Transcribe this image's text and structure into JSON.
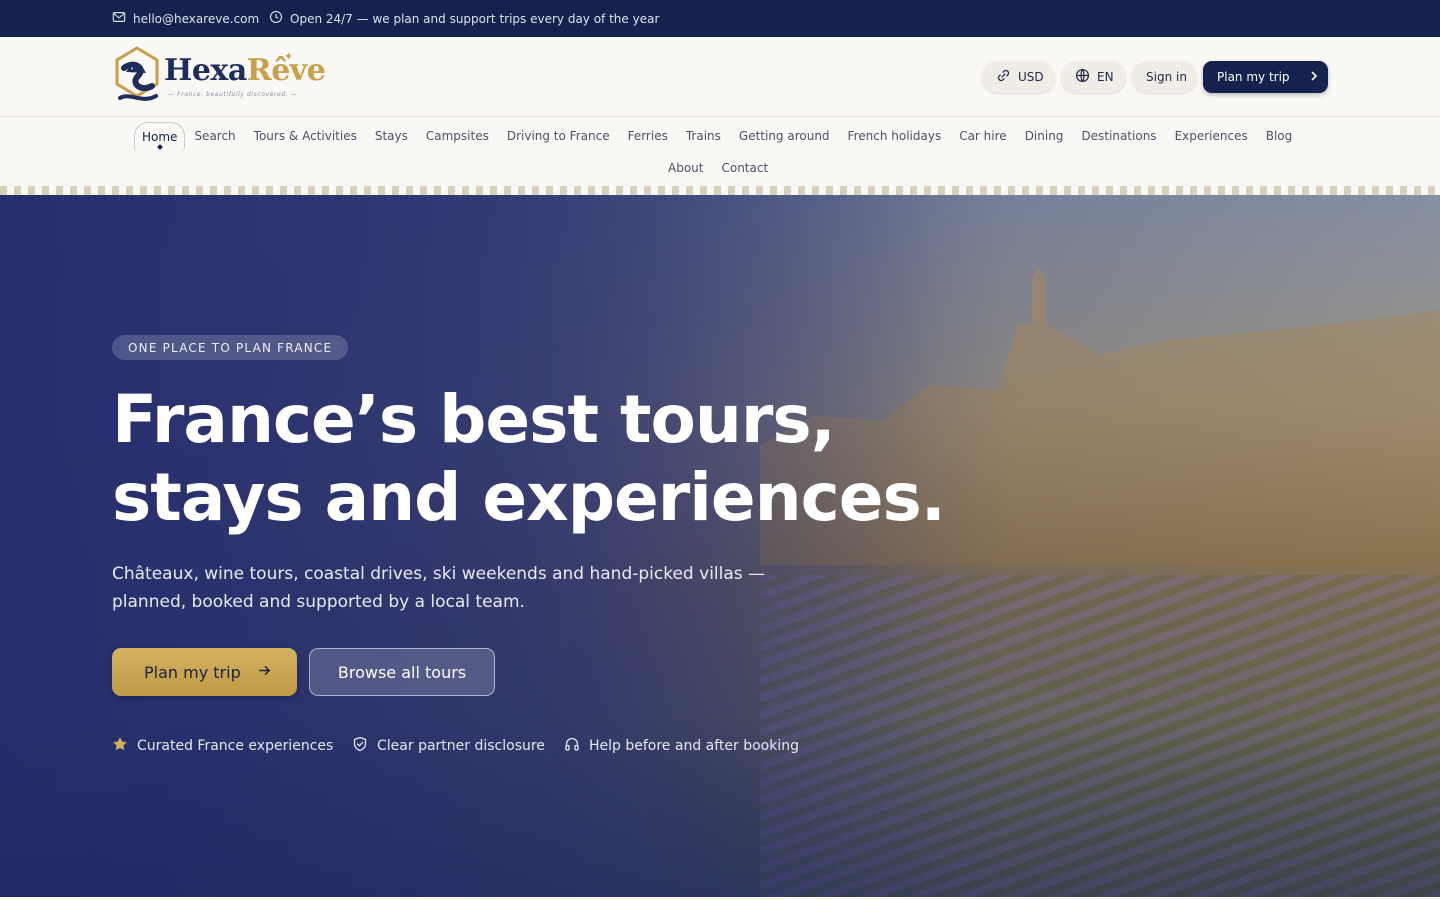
{
  "topbar": {
    "email": "hello@hexareve.com",
    "hours": "Open 24/7 — we plan and support trips every day of the year",
    "email_icon": "mail-icon",
    "hours_icon": "clock-icon"
  },
  "brand": {
    "name_part1": "Hexa",
    "name_part2": "Rêve",
    "tagline": "— France, beautifully discovered. —",
    "colors": {
      "navy": "#14224d",
      "gold": "#c9a14a"
    }
  },
  "header": {
    "currency": "USD",
    "language": "EN",
    "sign_in": "Sign in",
    "cta": "Plan my trip"
  },
  "nav": {
    "items": [
      "Home",
      "Search",
      "Tours & Activities",
      "Stays",
      "Campsites",
      "Driving to France",
      "Ferries",
      "Trains",
      "Getting around",
      "French holidays",
      "Car hire",
      "Dining",
      "Destinations",
      "Experiences",
      "Blog",
      "About",
      "Contact"
    ],
    "active": "Home"
  },
  "hero": {
    "eyebrow": "ONE PLACE TO PLAN FRANCE",
    "headline_line1": "France’s best tours,",
    "headline_line2": "stays and experiences.",
    "subtext_line1": "Châteaux, wine tours, coastal drives, ski weekends and hand-picked villas —",
    "subtext_line2": "planned, booked and supported by a local team.",
    "primary_cta": "Plan my trip",
    "secondary_cta": "Browse all tours",
    "features": [
      {
        "icon": "star-icon",
        "label": "Curated France experiences"
      },
      {
        "icon": "shield-check-icon",
        "label": "Clear partner disclosure"
      },
      {
        "icon": "headphones-icon",
        "label": "Help before and after booking"
      }
    ]
  }
}
